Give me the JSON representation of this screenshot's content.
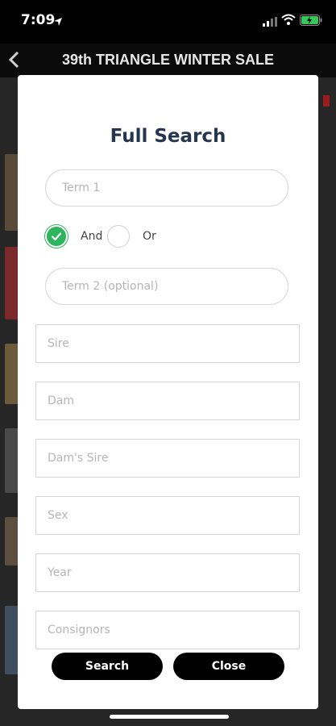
{
  "status_bar": {
    "time": "7:09"
  },
  "app_bar": {
    "title": "39th TRIANGLE WINTER SALE"
  },
  "modal": {
    "title": "Full Search",
    "term1_placeholder": "Term 1",
    "operator": {
      "selected": "And",
      "and_label": "And",
      "or_label": "Or"
    },
    "term2_placeholder": "Term 2 (optional)",
    "fields": [
      {
        "key": "sire",
        "placeholder": "Sire"
      },
      {
        "key": "dam",
        "placeholder": "Dam"
      },
      {
        "key": "dams_sire",
        "placeholder": "Dam's Sire"
      },
      {
        "key": "sex",
        "placeholder": "Sex"
      },
      {
        "key": "year",
        "placeholder": "Year"
      },
      {
        "key": "consignors",
        "placeholder": "Consignors"
      }
    ],
    "search_label": "Search",
    "close_label": "Close"
  },
  "colors": {
    "accent_green": "#2db55d",
    "title_navy": "#26364f"
  }
}
